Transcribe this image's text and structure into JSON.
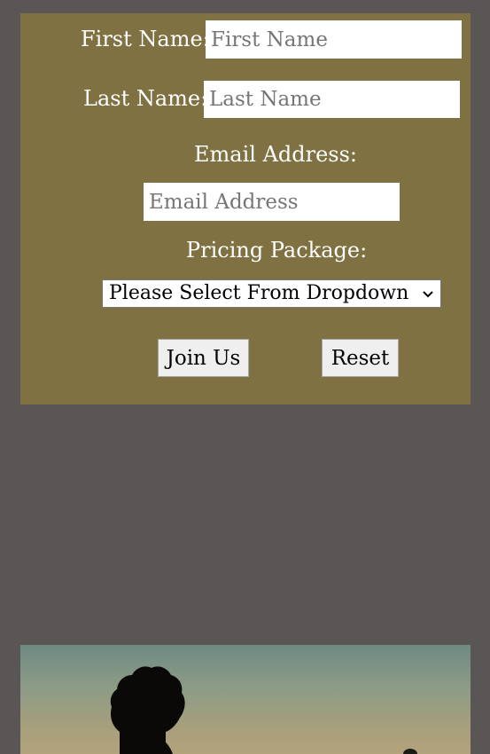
{
  "form": {
    "first_name": {
      "label": "First Name:",
      "placeholder": "First Name",
      "value": ""
    },
    "last_name": {
      "label": "Last Name:",
      "placeholder": "Last Name",
      "value": ""
    },
    "email": {
      "label": "Email Address:",
      "placeholder": "Email Address",
      "value": ""
    },
    "pricing": {
      "label": "Pricing Package:",
      "selected": "Please Select From Dropdown"
    },
    "join_label": "Join Us",
    "reset_label": "Reset"
  },
  "colors": {
    "page_background": "#5a5655",
    "panel_background": "#7f7141",
    "label_text": "#ffffff"
  },
  "icons": {
    "select_arrow": "chevron-down-icon"
  }
}
